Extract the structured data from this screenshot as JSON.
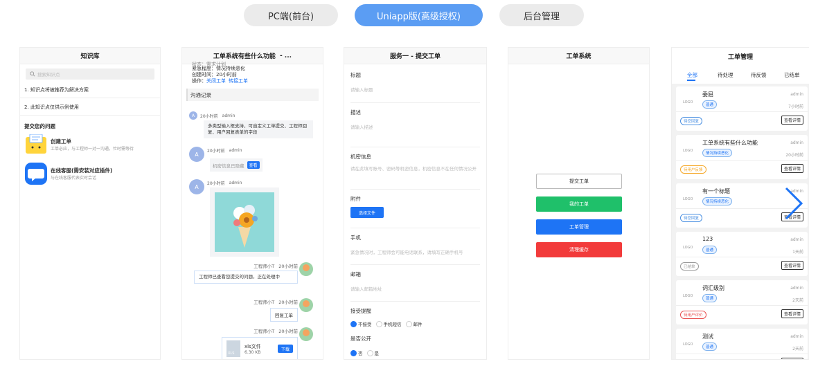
{
  "tabs": [
    {
      "label": "PC端(前台)",
      "active": false
    },
    {
      "label": "Uniapp版(高级授权)",
      "active": true
    },
    {
      "label": "后台管理",
      "active": false
    }
  ],
  "colors": {
    "accent": "#5b9df3",
    "blue": "#1e74f5",
    "green": "#1fc06a",
    "red": "#f23b3b"
  },
  "kb": {
    "title": "知识库",
    "search_placeholder": "搜索知识点",
    "items": [
      "1. 知识点将被推荐为解决方案",
      "2. 此知识点仅供示例使用"
    ],
    "submit_heading": "提交您的问题",
    "create_title": "创建工单",
    "create_desc": "工单必应，与工程师一对一沟通，忙时需等待",
    "service_title": "在线客服(需安装对应插件)",
    "service_desc": "与在线客服代表实时会话"
  },
  "detail": {
    "title": "工单系统有些什么功能",
    "title_more": "- ...",
    "cut_line": "状态：需求计划",
    "urgency": "紧急程度：情况持续恶化",
    "created": "创建时间：20小时前",
    "ops_label": "操作：",
    "op_close": "关闭工单",
    "op_transfer": "转接工单",
    "section": "沟通记录",
    "msgs": [
      {
        "time": "20小时前",
        "user": "admin",
        "text": "多类型输入框支持，可自定义工单提交、工程师回复、用户回复表单的字段"
      },
      {
        "time": "20小时前",
        "user": "admin",
        "text": "机密信息已隐藏",
        "btn": "查看"
      },
      {
        "time": "20小时前",
        "user": "admin"
      },
      {
        "time": "20小时前",
        "user": "工程师小T",
        "text": "工程师已查看您提交的问题，正在处理中"
      },
      {
        "time": "20小时前",
        "user": "工程师小T",
        "text": "回复工单"
      },
      {
        "time": "20小时前",
        "user": "工程师小T",
        "file": "xls文件",
        "size": "6.30 KB",
        "btn": "下载",
        "ext": "XLS"
      }
    ],
    "avatar_letter": "A"
  },
  "form": {
    "title": "服务一 - 提交工单",
    "fields": [
      {
        "label": "标题",
        "placeholder": "请输入标题"
      },
      {
        "label": "描述",
        "placeholder": "请输入描述"
      },
      {
        "label": "机密信息",
        "placeholder": "请在此填写账号、密码等机密信息，机密信息不在任何情况公开"
      },
      {
        "label": "附件",
        "button": "选择文件"
      },
      {
        "label": "手机",
        "placeholder": "紧急情况时，工程师会可能电话联系，请填写正确手机号"
      },
      {
        "label": "邮箱",
        "placeholder": "请输入邮箱地址"
      }
    ],
    "notify_label": "接受提醒",
    "notify_options": [
      "不接受",
      "手机短信",
      "邮件"
    ],
    "public_label": "是否公开",
    "public_options": [
      "否",
      "是"
    ]
  },
  "system": {
    "title": "工单系统",
    "buttons": [
      "提交工单",
      "我的工单",
      "工单管理",
      "清理缓存"
    ]
  },
  "manage": {
    "title": "工单管理",
    "tabs": [
      "全部",
      "待处理",
      "待反馈",
      "已结单"
    ],
    "view_label": "查看详情",
    "logo": "LOGO",
    "tickets": [
      {
        "title": "委屈",
        "user": "admin",
        "tag": "普通",
        "time": "7小时前",
        "status": "待您回复",
        "status_color": "#4a90e2"
      },
      {
        "title": "工单系统有些什么功能",
        "user": "admin",
        "tag": "情况持续恶化",
        "time": "20小时前",
        "status": "待用户反馈",
        "status_color": "#f5a623"
      },
      {
        "title": "有一个标题",
        "user": "admin",
        "tag": "情况持续恶化",
        "time": "",
        "status": "待您回复",
        "status_color": "#4a90e2"
      },
      {
        "title": "123",
        "user": "admin",
        "tag": "普通",
        "time": "1天前",
        "status": "已结单",
        "status_color": "#999999"
      },
      {
        "title": "词汇级别",
        "user": "admin",
        "tag": "普通",
        "time": "2天前",
        "status": "待用户评价",
        "status_color": "#e94e4e"
      },
      {
        "title": "测试",
        "user": "admin",
        "tag": "普通",
        "time": "2天前",
        "status": "",
        "status_color": "#999999"
      }
    ]
  }
}
